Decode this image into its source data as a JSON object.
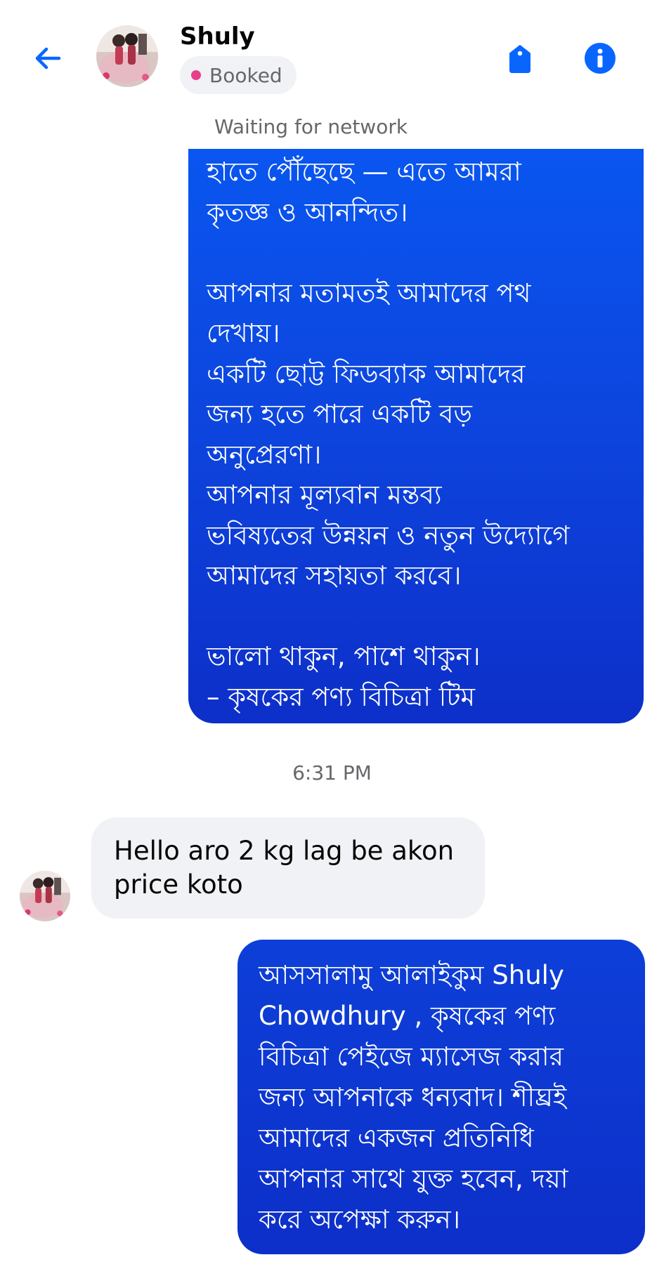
{
  "header": {
    "contact_name": "Shuly",
    "status_badge": "Booked",
    "back_icon": "arrow-left-icon",
    "tag_icon": "tag-icon",
    "info_icon": "info-icon",
    "accent_color": "#0866ff",
    "badge_dot_color": "#e83e8c"
  },
  "status_text": "Waiting for network",
  "messages": [
    {
      "direction": "outgoing",
      "text": "হাতে পৌঁছেছে — এতে আমরা\nকৃতজ্ঞ ও আনন্দিত।\n\nআপনার মতামতই আমাদের পথ\nদেখায়।\nএকটি ছোট্ট ফিডব্যাক আমাদের\nজন্য হতে পারে একটি বড়\nঅনুপ্রেরণা।\nআপনার মূল্যবান মন্তব্য\nভবিষ্যতের উন্নয়ন ও নতুন উদ্যোগে\nআমাদের সহায়তা করবে।\n\nভালো থাকুন, পাশে থাকুন।\n– কৃষকের পণ্য বিচিত্রা টিম"
    },
    {
      "direction": "incoming",
      "text": "Hello aro 2 kg lag be akon\nprice koto"
    },
    {
      "direction": "outgoing",
      "text": "আসসালামু আলাইকুম Shuly\nChowdhury , কৃষকের পণ্য\nবিচিত্রা পেইজে ম্যাসেজ করার\nজন্য আপনাকে ধন্যবাদ। শীঘ্রই\nআমাদের একজন প্রতিনিধি\nআপনার সাথে যুক্ত হবেন, দয়া\nকরে অপেক্ষা করুন।"
    }
  ],
  "timestamp": "6:31 PM"
}
